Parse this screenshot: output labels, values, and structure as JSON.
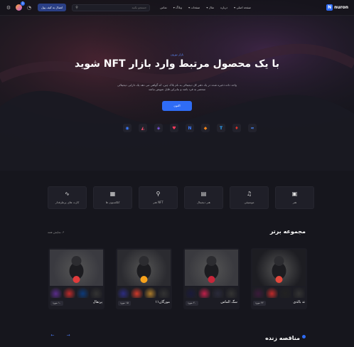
{
  "header": {
    "logo_mark": "N",
    "logo_text": "nuron",
    "nav": [
      "صفحه اصلی ▾",
      "درباره",
      "مثال ▾",
      "صفحات ▾",
      "وبلاگ ▾",
      "تماس"
    ],
    "search_placeholder": "جستجو بکنید",
    "wallet_button": "اتصال به کیف پول",
    "notification_count": "1"
  },
  "hero": {
    "tag": "بازار نورون",
    "title": "با یک محصول مرتبط وارد بازار NFT شوید",
    "description": "واحد داده ذخیره شده در یک دفتر کل دیجیتالی به نام بلاک چین، که گواهی می دهد یک دارایی دیجیتالی منحصر به فرد باشد و بنابراین قابل تعویض نباشد",
    "button": "اکنون",
    "partners": [
      {
        "icon": "circle-badge-icon",
        "glyph": "◉",
        "color": "#3b7bff"
      },
      {
        "icon": "triangle-logo-icon",
        "glyph": "◭",
        "color": "#ff4d6d"
      },
      {
        "icon": "shield-logo-icon",
        "glyph": "◈",
        "color": "#8a5cf6"
      },
      {
        "icon": "heart-logo-icon",
        "glyph": "♥",
        "color": "#ff3b5c"
      },
      {
        "icon": "n-logo-icon",
        "glyph": "N",
        "color": "#3b7bff"
      },
      {
        "icon": "fox-logo-icon",
        "glyph": "◆",
        "color": "#f6851b"
      },
      {
        "icon": "t-logo-icon",
        "glyph": "T",
        "color": "#2ea8ff"
      },
      {
        "icon": "crest-logo-icon",
        "glyph": "♦",
        "color": "#e2342b"
      },
      {
        "icon": "wave-logo-icon",
        "glyph": "≈",
        "color": "#4a8cff"
      }
    ]
  },
  "categories": [
    {
      "label": "کارت های پرطرفدار",
      "icon": "activity-icon",
      "glyph": "∿"
    },
    {
      "label": "کلکسیون ها",
      "icon": "grid-icon",
      "glyph": "▦"
    },
    {
      "label": "هنر NFT",
      "icon": "search-icon",
      "glyph": "⚲"
    },
    {
      "label": "هنر دیجیتال",
      "icon": "map-icon",
      "glyph": "▤"
    },
    {
      "label": "موسیقی",
      "icon": "music-icon",
      "glyph": "♫"
    },
    {
      "label": "هنر",
      "icon": "image-icon",
      "glyph": "▣"
    }
  ],
  "top_collection": {
    "title": "مجموعه برتر",
    "view_all": "نمایش همه ↗",
    "cards": [
      {
        "name": "پرتقال",
        "count": "۱۰ مورد",
        "accent": "#e23b3b"
      },
      {
        "name": "مورگان۱۱",
        "count": "۱۵ مورد",
        "accent": "#f7a21b"
      },
      {
        "name": "سگ الماس",
        "count": "۲۰ مورد",
        "accent": "#c8263a"
      },
      {
        "name": "تد بالدی",
        "count": "۲۲ مورد",
        "accent": "#e3483c"
      }
    ]
  },
  "live_auction": {
    "title": "مناقصه زنده",
    "prev": "←",
    "next": "→"
  }
}
